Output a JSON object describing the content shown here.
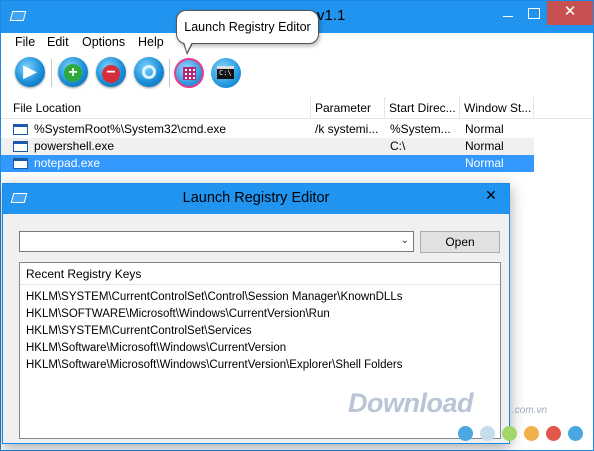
{
  "window": {
    "title": "v1.1",
    "close_glyph": "✕"
  },
  "menu": [
    "File",
    "Edit",
    "Options",
    "Help"
  ],
  "toolbar": {
    "buttons": [
      "run-icon",
      "add-icon",
      "remove-icon",
      "properties-icon",
      "launch-registry-editor-icon",
      "command-prompt-icon"
    ],
    "cmd_glyph": "C:\\"
  },
  "tooltip": "Launch Registry Editor",
  "list": {
    "columns": [
      "File Location",
      "Parameter",
      "Start Direc...",
      "Window St..."
    ],
    "rows": [
      {
        "file": "%SystemRoot%\\System32\\cmd.exe",
        "param": "/k systemi...",
        "start": "%System...",
        "window": "Normal"
      },
      {
        "file": "powershell.exe",
        "param": "",
        "start": "C:\\",
        "window": "Normal"
      },
      {
        "file": "notepad.exe",
        "param": "",
        "start": "",
        "window": "Normal"
      }
    ]
  },
  "dialog": {
    "title": "Launch Registry Editor",
    "close_glyph": "✕",
    "combo_value": "",
    "combo_arrow": "⌄",
    "open_label": "Open",
    "recent_header": "Recent Registry Keys",
    "recent_keys": [
      "HKLM\\SYSTEM\\CurrentControlSet\\Control\\Session Manager\\KnownDLLs",
      "HKLM\\SOFTWARE\\Microsoft\\Windows\\CurrentVersion\\Run",
      "HKLM\\SYSTEM\\CurrentControlSet\\Services",
      "HKLM\\Software\\Microsoft\\Windows\\CurrentVersion",
      "HKLM\\Software\\Microsoft\\Windows\\CurrentVersion\\Explorer\\Shell Folders"
    ]
  },
  "watermark": {
    "main": "Download",
    "sub": ".com.vn"
  },
  "colors": {
    "titlebar": "#2194f0",
    "selection": "#3399ff",
    "dots": [
      "#4aa8e0",
      "#9ad0ef",
      "#a3d66a",
      "#f0b04b",
      "#e2574c",
      "#4aa8e0"
    ]
  }
}
